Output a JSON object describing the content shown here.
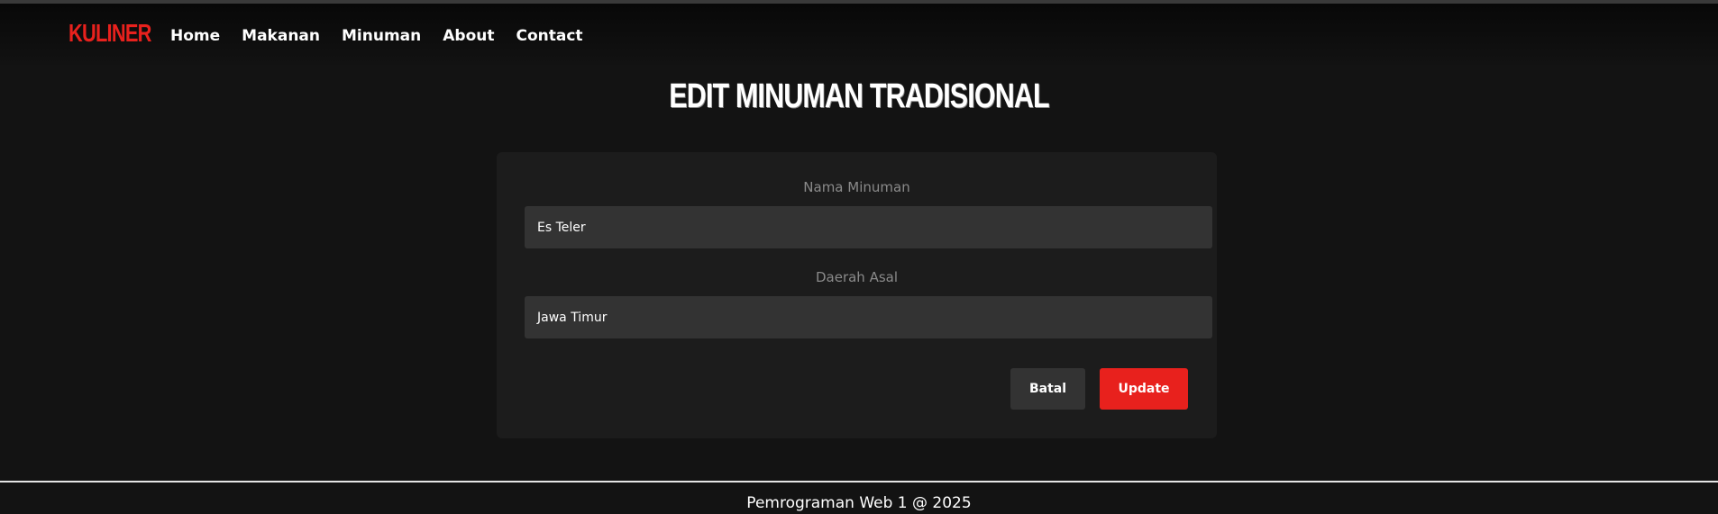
{
  "header": {
    "brand": "KULINER",
    "nav": [
      "Home",
      "Makanan",
      "Minuman",
      "About",
      "Contact"
    ]
  },
  "page": {
    "title": "EDIT MINUMAN TRADISIONAL"
  },
  "form": {
    "nama_label": "Nama Minuman",
    "nama_value": "Es Teler",
    "daerah_label": "Daerah Asal",
    "daerah_value": "Jawa Timur",
    "batal_label": "Batal",
    "update_label": "Update"
  },
  "footer": {
    "text": "Pemrograman Web 1 @ 2025"
  },
  "colors": {
    "accent": "#e8211d",
    "background": "#131313",
    "card": "#1c1c1c",
    "input": "#333333"
  }
}
